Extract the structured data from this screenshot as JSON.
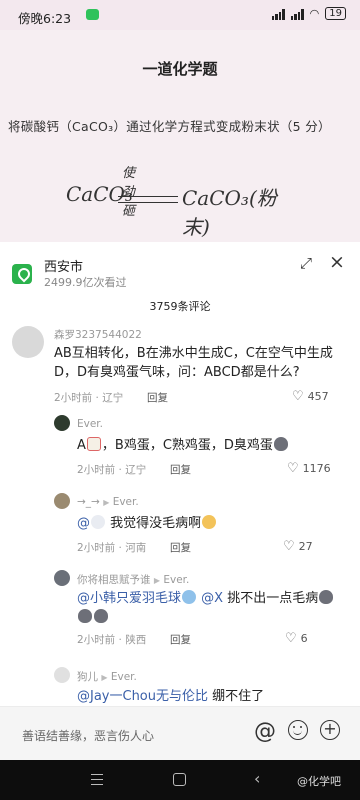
{
  "status_bar": {
    "time": "傍晚6:23",
    "battery": "19"
  },
  "video": {
    "title": "一道化学题",
    "question": "将碳酸钙（CaCO₃）通过化学方程式变成粉末状（5 分）",
    "equation_left": "CaCO₃",
    "equation_condition": "使劲砸",
    "equation_right": "CaCO₃(粉末)"
  },
  "location": {
    "name": "西安市",
    "views": "2499.9亿次看过"
  },
  "comment_count": "3759条评论",
  "comments": [
    {
      "user": "森罗3237544022",
      "text": "AB互相转化，B在沸水中生成C，C在空气中生成D，D有臭鸡蛋气味，问：ABCD都是什么?",
      "time": "2小时前",
      "region": "辽宁",
      "reply": "回复",
      "likes": "457"
    },
    {
      "user": "Ever.",
      "text_a": "A",
      "text_b": "，B鸡蛋，C熟鸡蛋，D臭鸡蛋",
      "time": "2小时前",
      "region": "辽宁",
      "reply": "回复",
      "likes": "1176"
    },
    {
      "user_from": "→_→",
      "user_to": "Ever.",
      "mention": "@",
      "text": " 我觉得没毛病啊",
      "time": "2小时前",
      "region": "河南",
      "reply": "回复",
      "likes": "27"
    },
    {
      "user_from": "你将相思赋予谁",
      "user_to": "Ever.",
      "mention1": "@小韩只爱羽毛球",
      "mention2": "@X",
      "text": " 挑不出一点毛病",
      "time": "2小时前",
      "region": "陕西",
      "reply": "回复",
      "likes": "6"
    },
    {
      "user_from": "狗儿",
      "user_to": "Ever.",
      "mention": "@Jay一Chou无与伦比",
      "text": " 绷不住了"
    }
  ],
  "input": {
    "placeholder": "善语结善缘，恶言伤人心"
  },
  "watermark": "@化学吧"
}
